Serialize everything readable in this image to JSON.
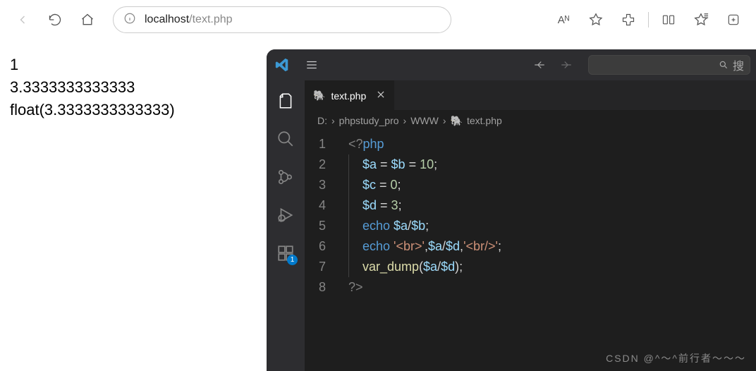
{
  "browser": {
    "url_host": "localhost",
    "url_path": "/text.php",
    "read_aloud": "Aᴺ",
    "search_char": "搜"
  },
  "page_output": {
    "l1": "1",
    "l2": "3.3333333333333",
    "l3": "float(3.3333333333333)"
  },
  "vscode": {
    "tab_name": "text.php",
    "ext_badge": "1",
    "crumbs": {
      "d": "D:",
      "p1": "phpstudy_pro",
      "p2": "WWW",
      "file": "text.php"
    },
    "lines": {
      "1": {
        "n": "1"
      },
      "2": {
        "n": "2"
      },
      "3": {
        "n": "3"
      },
      "4": {
        "n": "4"
      },
      "5": {
        "n": "5"
      },
      "6": {
        "n": "6"
      },
      "7": {
        "n": "7"
      },
      "8": {
        "n": "8"
      }
    },
    "code": {
      "l1_open": "<?",
      "l1_php": "php",
      "va": "$a",
      "vb": "$b",
      "vc": "$c",
      "vd": "$d",
      "eq": " = ",
      "semi": ";",
      "ten": "10",
      "zero": "0",
      "three": "3",
      "echo": "echo ",
      "slash": "/",
      "br1": "'<br>'",
      "comma": ",",
      "br2": "'<br/>'",
      "vdump": "var_dump",
      "lp": "(",
      "rp": ")",
      "close": "?>"
    }
  },
  "watermark": "CSDN @^～^前行者～～～"
}
